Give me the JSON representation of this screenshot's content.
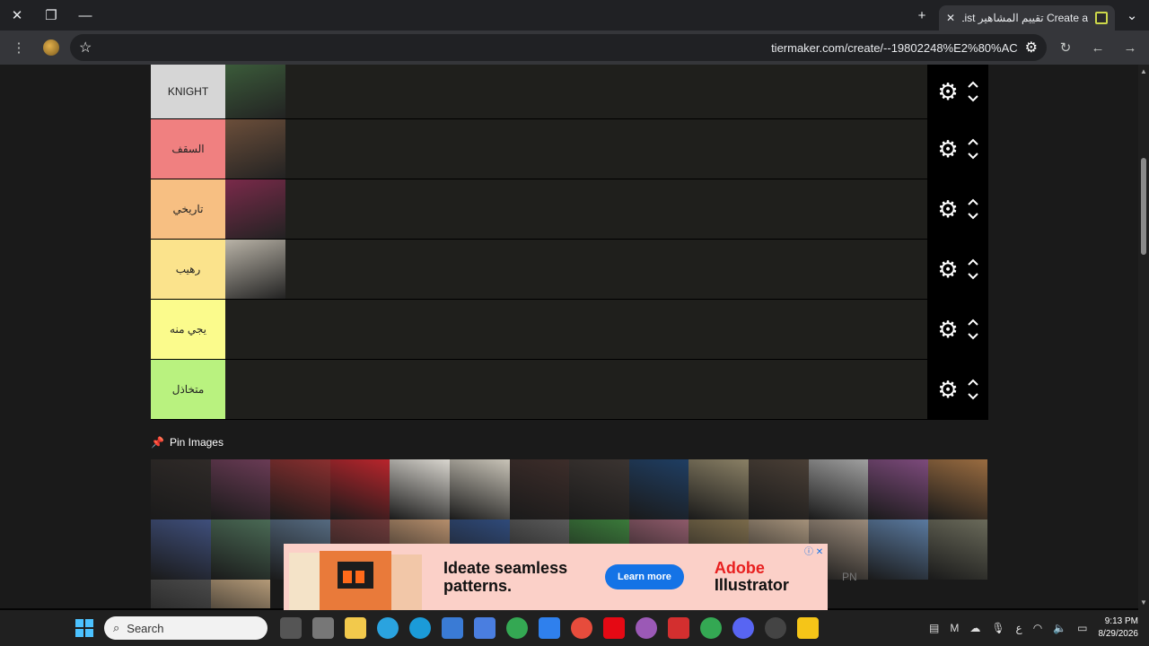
{
  "browser": {
    "tab_title": "Create a تقييم المشاهير Tier List",
    "url": "tiermaker.com/create/--19802248%E2%80%AC",
    "close_symbol": "✕",
    "new_tab_symbol": "+"
  },
  "tiers": [
    {
      "label": "KNIGHT",
      "color": "#d6d6d6",
      "images": [
        "#3b5b3a"
      ]
    },
    {
      "label": "السقف",
      "color": "#f08080",
      "images": [
        "#6b4e3a"
      ]
    },
    {
      "label": "تاريخي",
      "color": "#f7bf82",
      "images": [
        "#7a2a4a"
      ]
    },
    {
      "label": "رهيب",
      "color": "#fbe38c",
      "images": [
        "#b9b3a7"
      ]
    },
    {
      "label": "يجي منه",
      "color": "#fbfb8c",
      "images": []
    },
    {
      "label": "متخاذل",
      "color": "#b9f27f",
      "images": []
    }
  ],
  "pin_images_label": "Pin Images",
  "pool_colors": [
    "#2f2a28",
    "#6a3b55",
    "#8a2f2f",
    "#b9252c",
    "#d9d6cf",
    "#c9c4b8",
    "#3d2d2a",
    "#3b3431",
    "#1f3e63",
    "#8a8065",
    "#4a3f36",
    "#a0a0a0",
    "#7d4a7c",
    "#9a6c40",
    "#3f4f7c",
    "#4a6a55",
    "#556a80",
    "#6e3a3a",
    "#b58e6c",
    "#2f4a7a",
    "#5a5a5a",
    "#3a7a3a",
    "#8e5a6a",
    "#7a6a4a",
    "#a4917a",
    "#9a8a7a",
    "#5a7aa0",
    "#6a6a5a",
    "#4a4a4a",
    "#b49a78"
  ],
  "ad": {
    "headline": "Ideate seamless patterns.",
    "button": "Learn more",
    "brand_line1": "Adobe",
    "brand_line2": "Illustrator",
    "side_text": "PN",
    "info": "ⓘ ✕"
  },
  "taskbar": {
    "search_placeholder": "Search",
    "time": "9:13 PM",
    "date": "8/29/2026",
    "ime": "ع"
  }
}
